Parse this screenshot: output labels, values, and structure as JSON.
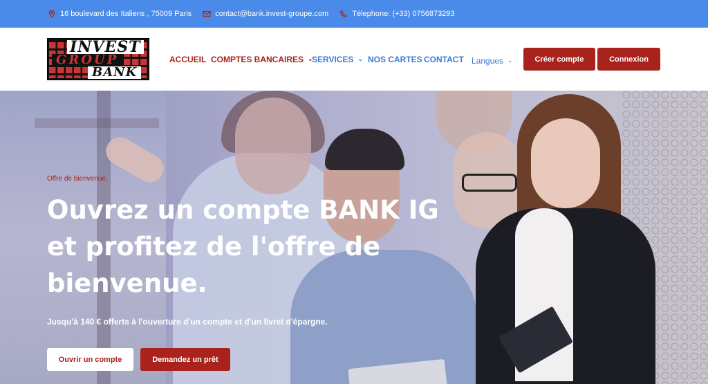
{
  "topbar": {
    "address": "16 boulevard des Italiens , 75009 Paris",
    "email": "contact@bank.invest-groupe.com",
    "phone": "Télephone: (+33) 0756873293"
  },
  "logo": {
    "line1": "INVEST",
    "line2": "GROUP",
    "line3": "BANK"
  },
  "nav": {
    "items": [
      {
        "label": "ACCUEIL",
        "dropdown": false,
        "color": "#a8231c"
      },
      {
        "label": "COMPTES BANCAIRES",
        "dropdown": true,
        "color": "#a8231c"
      },
      {
        "label": "SERVICES",
        "dropdown": true,
        "color": "#3b7bd4"
      },
      {
        "label": "NOS CARTES",
        "dropdown": false,
        "color": "#3b7bd4"
      },
      {
        "label": "CONTACT",
        "dropdown": false,
        "color": "#3b7bd4"
      },
      {
        "label": "Langues",
        "dropdown": true,
        "color": "#3b7bd4"
      }
    ],
    "create_account": "Créer compte",
    "login": "Connexion"
  },
  "hero": {
    "offer": "Offre de bienvenue.",
    "title": "Ouvrez un compte BANK IG et profitez de l'offre de bienvenue.",
    "subtitle": "Jusqu'à 140 € offerts à l'ouverture d'un compte et d'un livret d'épargne.",
    "open_account": "Ouvrir un compte",
    "request_loan": "Demandez un prêt"
  },
  "colors": {
    "topbar": "#4a8ae8",
    "brand_red": "#a8231c",
    "nav_blue": "#3b7bd4"
  }
}
